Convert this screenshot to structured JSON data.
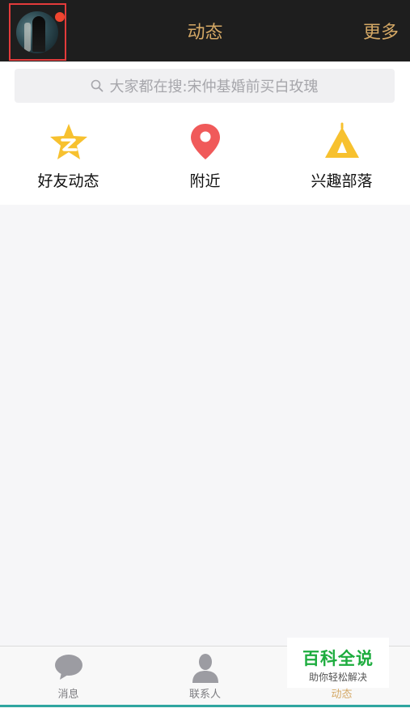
{
  "header": {
    "title": "动态",
    "more_label": "更多"
  },
  "search": {
    "placeholder": "大家都在搜:宋仲基婚前买白玫瑰"
  },
  "quick_links": [
    {
      "label": "好友动态",
      "icon": "star-z-icon",
      "color": "#f7c12f"
    },
    {
      "label": "附近",
      "icon": "location-pin-icon",
      "color": "#f05a5a"
    },
    {
      "label": "兴趣部落",
      "icon": "tent-icon",
      "color": "#f7c12f"
    }
  ],
  "tabbar": {
    "tabs": [
      {
        "label": "消息",
        "icon": "chat-bubble-icon"
      },
      {
        "label": "联系人",
        "icon": "person-icon"
      },
      {
        "label": "动态",
        "icon": "star-icon",
        "active": true
      }
    ]
  },
  "watermark": {
    "title": "百科全说",
    "subtitle": "助你轻松解决"
  },
  "colors": {
    "header_bg": "#1e1e1e",
    "accent_gold": "#d4a865",
    "notify_red": "#f0452f",
    "watermark_green": "#1dac3e"
  }
}
